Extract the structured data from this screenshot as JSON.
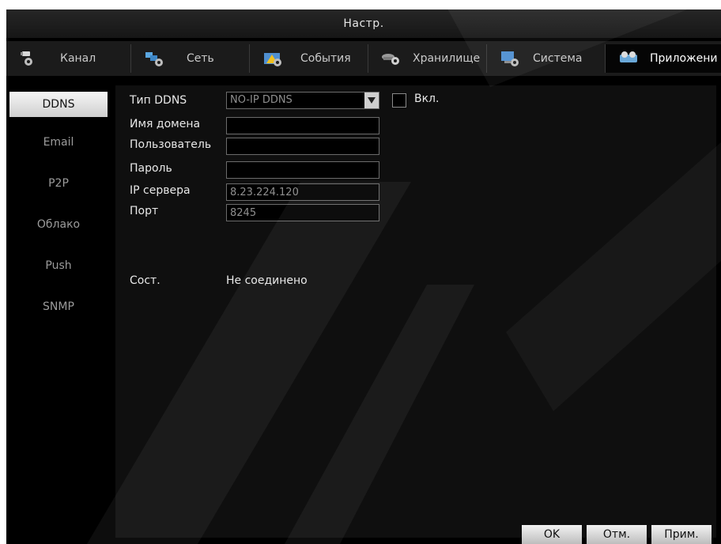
{
  "window": {
    "title": "Настр."
  },
  "tabs": [
    {
      "label": "Канал",
      "icon": "camera-gear-icon"
    },
    {
      "label": "Сеть",
      "icon": "network-gear-icon"
    },
    {
      "label": "События",
      "icon": "warning-gear-icon"
    },
    {
      "label": "Хранилище",
      "icon": "storage-gear-icon"
    },
    {
      "label": "Система",
      "icon": "system-gear-icon"
    },
    {
      "label": "Приложени",
      "icon": "apps-icon",
      "active": true
    }
  ],
  "sidebar": {
    "items": [
      {
        "label": "DDNS",
        "active": true
      },
      {
        "label": "Email"
      },
      {
        "label": "P2P"
      },
      {
        "label": "Облако"
      },
      {
        "label": "Push"
      },
      {
        "label": "SNMP"
      }
    ]
  },
  "form": {
    "ddns_type_label": "Тип DDNS",
    "ddns_type_value": "NO-IP DDNS",
    "enable_label": "Вкл.",
    "enable_checked": false,
    "domain_label": "Имя домена",
    "domain_value": "",
    "user_label": "Пользователь",
    "user_value": "",
    "password_label": "Пароль",
    "password_value": "",
    "server_ip_label": "IP сервера",
    "server_ip_value": "8.23.224.120",
    "port_label": "Порт",
    "port_value": "8245",
    "status_label": "Сост.",
    "status_value": "Не соединено"
  },
  "buttons": {
    "ok": "OK",
    "cancel": "Отм.",
    "apply": "Прим."
  },
  "colors": {
    "background": "#000000",
    "panel": "#0f0f0f",
    "text": "#e8e8e8",
    "muted_text": "#9c9c9c",
    "active_item": "#e6e6e6"
  }
}
